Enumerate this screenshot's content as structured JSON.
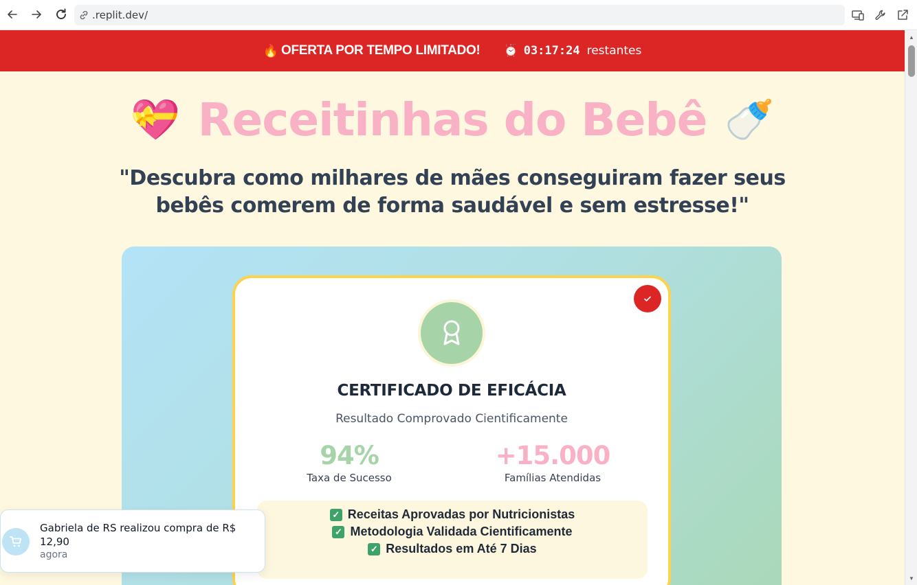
{
  "browser": {
    "url": ".replit.dev/"
  },
  "promo": {
    "fire_emoji": "🔥",
    "offer_text": "OFERTA POR TEMPO LIMITADO!",
    "clock_emoji": "⏰",
    "timer": "03:17:24",
    "remaining_label": "restantes",
    "color": "#dc2626"
  },
  "header": {
    "left_emoji": "💝",
    "title": "Receitinhas do Bebê",
    "right_emoji": "🍼",
    "subtitle": "\"Descubra como milhares de mães conseguiram fazer seus bebês comerem de forma saudável e sem estresse!\"",
    "title_color": "#f9b2c5"
  },
  "certificate": {
    "title": "CERTIFICADO DE EFICÁCIA",
    "subtitle": "Resultado Comprovado Cientificamente",
    "stats": [
      {
        "value": "94%",
        "label": "Taxa de Sucesso",
        "color": "#a7d3a8"
      },
      {
        "value": "+15.000",
        "label": "Famílias Atendidas",
        "color": "#f9b2c5"
      }
    ],
    "features": [
      "Receitas Aprovadas por Nutricionistas",
      "Metodologia Validada Cientificamente",
      "Resultados em Até 7 Dias"
    ],
    "border_color": "#fcd34d"
  },
  "toast": {
    "message": "Gabriela de RS realizou compra de R$ 12,90",
    "time": "agora"
  }
}
